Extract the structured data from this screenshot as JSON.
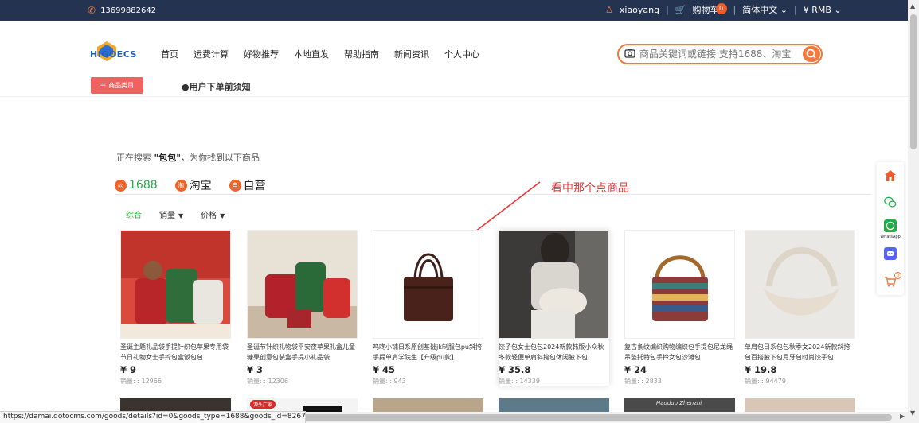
{
  "topbar": {
    "phone": "13699882642",
    "username": "xiaoyang",
    "cart_label": "购物车",
    "cart_count": "0",
    "language": "简体中文",
    "currency": "¥ RMB"
  },
  "nav": {
    "items": [
      "首页",
      "运费计算",
      "好物推荐",
      "本地直发",
      "帮助指南",
      "新闻资讯",
      "个人中心"
    ]
  },
  "search": {
    "placeholder": "商品关键词或链接 支持1688、淘宝"
  },
  "category_button": "商品类目",
  "notice": "用户下单前须知",
  "search_info": {
    "prefix": "正在搜索 ",
    "keyword": "\"包包\"",
    "suffix": "，为你找到以下商品"
  },
  "platforms": [
    {
      "label": "1688",
      "icon": "1688-icon"
    },
    {
      "label": "淘宝",
      "icon": "taobao-icon"
    },
    {
      "label": "自营",
      "icon": "self-icon"
    }
  ],
  "annotation": "看中那个点商品",
  "sort": {
    "general": "综合",
    "sales": "销量",
    "price": "价格"
  },
  "products": [
    {
      "name": "圣诞主题礼品袋手提针织包苹果专用袋节日礼物女士手拎包盒饭包包",
      "price": "¥ 9",
      "sales": "销量: : 12966"
    },
    {
      "name": "圣诞节针织礼物袋平安夜苹果礼盒儿童糖果创意包装盒手提小礼品袋",
      "price": "¥ 3",
      "sales": "销量: : 12306"
    },
    {
      "name": "呜咚小铺日系原创基础jk制服包pu斜挎手提单肩学院生【升级pu款】",
      "price": "¥ 45",
      "sales": "销量: : 943"
    },
    {
      "name": "饺子包女士包包2024新款韩版小众秋冬款轻便单肩斜挎包休闲腋下包",
      "price": "¥ 35.8",
      "sales": "销量: : 14339"
    },
    {
      "name": "复古条纹编织购物编织包手提包尼龙绳吊坠托特包手拎女包沙滩包",
      "price": "¥ 24",
      "sales": "销量: : 2833"
    },
    {
      "name": "单肩包日系包包秋季女2024新款斜挎包百搭腋下包月牙包时尚饺子包",
      "price": "¥ 19.8",
      "sales": "销量: : 94479"
    }
  ],
  "row2_labels": {
    "source_factory": "源头厂家",
    "banner_text": "Haoduo Zhenzhi"
  },
  "floatbar": {
    "whatsapp": "WhatsApp",
    "cart_count": "0"
  },
  "status_url": "https://damai.dotocms.com/goods/details?id=0&goods_type=1688&goods_id=8267...",
  "colors": {
    "accent": "#f5793b",
    "topbar_bg": "#233350",
    "green": "#2eaa4a",
    "red_btn": "#ef6262"
  }
}
